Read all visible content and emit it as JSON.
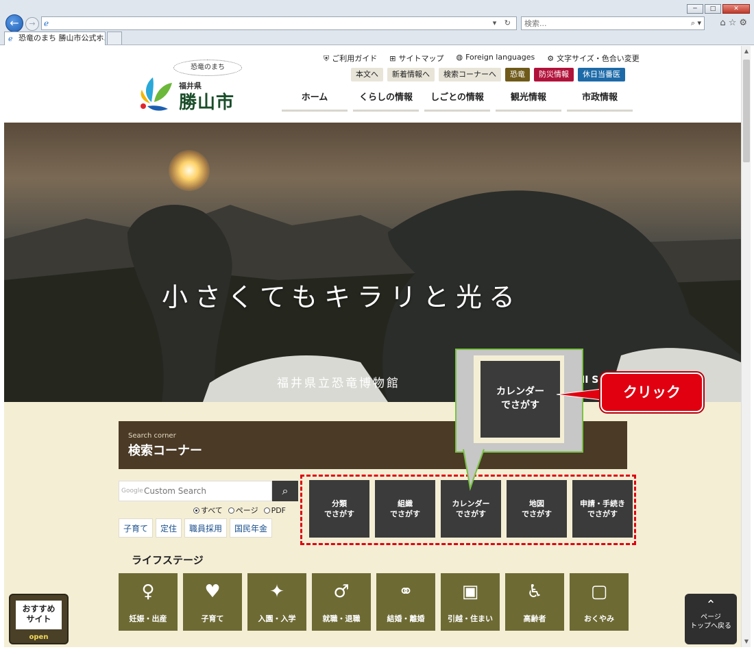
{
  "browser": {
    "tab_title": "恐竜のまち 勝山市公式ホ...",
    "search_placeholder": "検索...",
    "window_min": "─",
    "window_max": "□",
    "window_close": "✕"
  },
  "header": {
    "tagline": "恐竜のまち",
    "prefecture": "福井県",
    "city": "勝山市",
    "utility_links": [
      "ご利用ガイド",
      "サイトマップ",
      "Foreign languages",
      "文字サイズ・色合い変更"
    ],
    "sub_buttons": [
      "本文へ",
      "新着情報へ",
      "検索コーナーへ",
      "恐竜",
      "防災情報",
      "休日当番医"
    ],
    "global_nav": [
      "ホーム",
      "くらしの情報",
      "しごとの情報",
      "観光情報",
      "市政情報"
    ]
  },
  "hero": {
    "headline": "小さくてもキラリと光る",
    "caption": "福井県立恐竜博物館",
    "pager": "II S"
  },
  "search_corner": {
    "label_en": "Search corner",
    "title": "検索コーナー",
    "google_logo": "Google",
    "placeholder": "Custom Search",
    "radio_options": [
      "すべて",
      "ページ",
      "PDF"
    ],
    "keywords": [
      "子育て",
      "定住",
      "職員採用",
      "国民年金"
    ],
    "categories": [
      {
        "line1": "分類",
        "line2": "でさがす"
      },
      {
        "line1": "組織",
        "line2": "でさがす"
      },
      {
        "line1": "カレンダー",
        "line2": "でさがす"
      },
      {
        "line1": "地図",
        "line2": "でさがす"
      },
      {
        "line1": "申請・手続き",
        "line2": "でさがす"
      }
    ]
  },
  "life_stage": {
    "title": "ライフステージ",
    "items": [
      "妊娠・出産",
      "子育て",
      "入園・入学",
      "就職・退職",
      "結婚・離婚",
      "引越・住まい",
      "高齢者",
      "おくやみ"
    ]
  },
  "floating": {
    "recommended_line1": "おすすめ",
    "recommended_line2": "サイト",
    "recommended_open": "open",
    "pagetop_line1": "ページ",
    "pagetop_line2": "トップへ戻る"
  },
  "annotation": {
    "zoom_line1": "カレンダー",
    "zoom_line2": "でさがす",
    "click_label": "クリック",
    "highlight_color": "#e00010",
    "zoom_border_color": "#7ac143"
  },
  "colors": {
    "search_header_bg": "#4a3a26",
    "category_tile_bg": "#3b3b3b",
    "life_stage_bg": "#6d6a34",
    "page_bg": "#f4eed5"
  }
}
